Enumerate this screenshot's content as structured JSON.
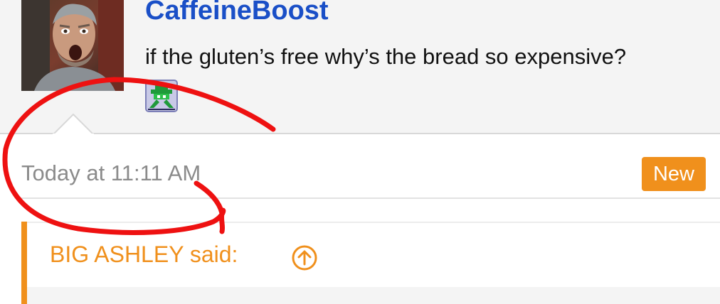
{
  "post": {
    "username": "CaffeineBoost",
    "user_title": "if the gluten’s free why’s the bread so expensive?",
    "timestamp": "Today at 11:11 AM",
    "new_label": "New"
  },
  "quote": {
    "author_label": "BIG ASHLEY said:"
  },
  "colors": {
    "username": "#1a4fc7",
    "accent_orange": "#f0901c",
    "timestamp_gray": "#8b8b8b",
    "annotation_red": "#ee1111"
  },
  "icons": {
    "badge": "green-space-invader-icon",
    "quote_jump": "circle-arrow-up-icon"
  }
}
